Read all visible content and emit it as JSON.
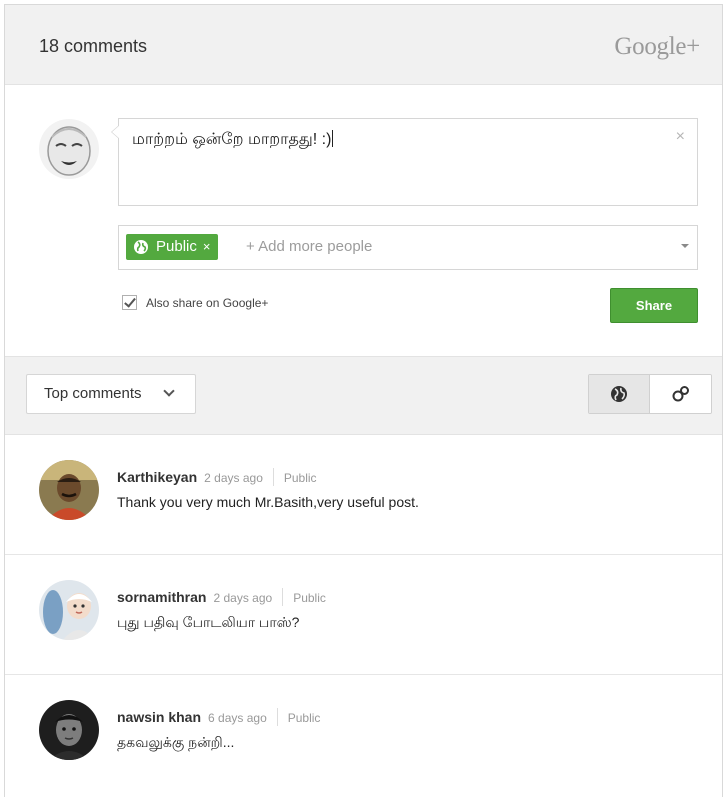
{
  "header": {
    "comment_count": "18 comments",
    "brand": "Google+"
  },
  "composer": {
    "text": "மாற்றம் ஒன்றே மாறாதது! :)",
    "close_icon": "×",
    "audience_chip": "Public",
    "audience_chip_remove": "×",
    "add_people_placeholder": "+ Add more people",
    "also_share_label": "Also share on Google+",
    "also_share_checked": true,
    "share_button": "Share"
  },
  "toolbar": {
    "sort_label": "Top comments",
    "view_options": [
      "globe-icon",
      "link-icon"
    ],
    "selected_view": "globe-icon"
  },
  "colors": {
    "accent_green": "#53a93f",
    "header_bg": "#f1f1f1"
  },
  "comments": [
    {
      "author": "Karthikeyan",
      "time": "2 days ago",
      "visibility": "Public",
      "text": "Thank you very much Mr.Basith,very useful post."
    },
    {
      "author": "sornamithran",
      "time": "2 days ago",
      "visibility": "Public",
      "text": "புது பதிவு போடலியா பாஸ்?"
    },
    {
      "author": "nawsin khan",
      "time": "6 days ago",
      "visibility": "Public",
      "text": "தகவலுக்கு நன்றி..."
    }
  ]
}
